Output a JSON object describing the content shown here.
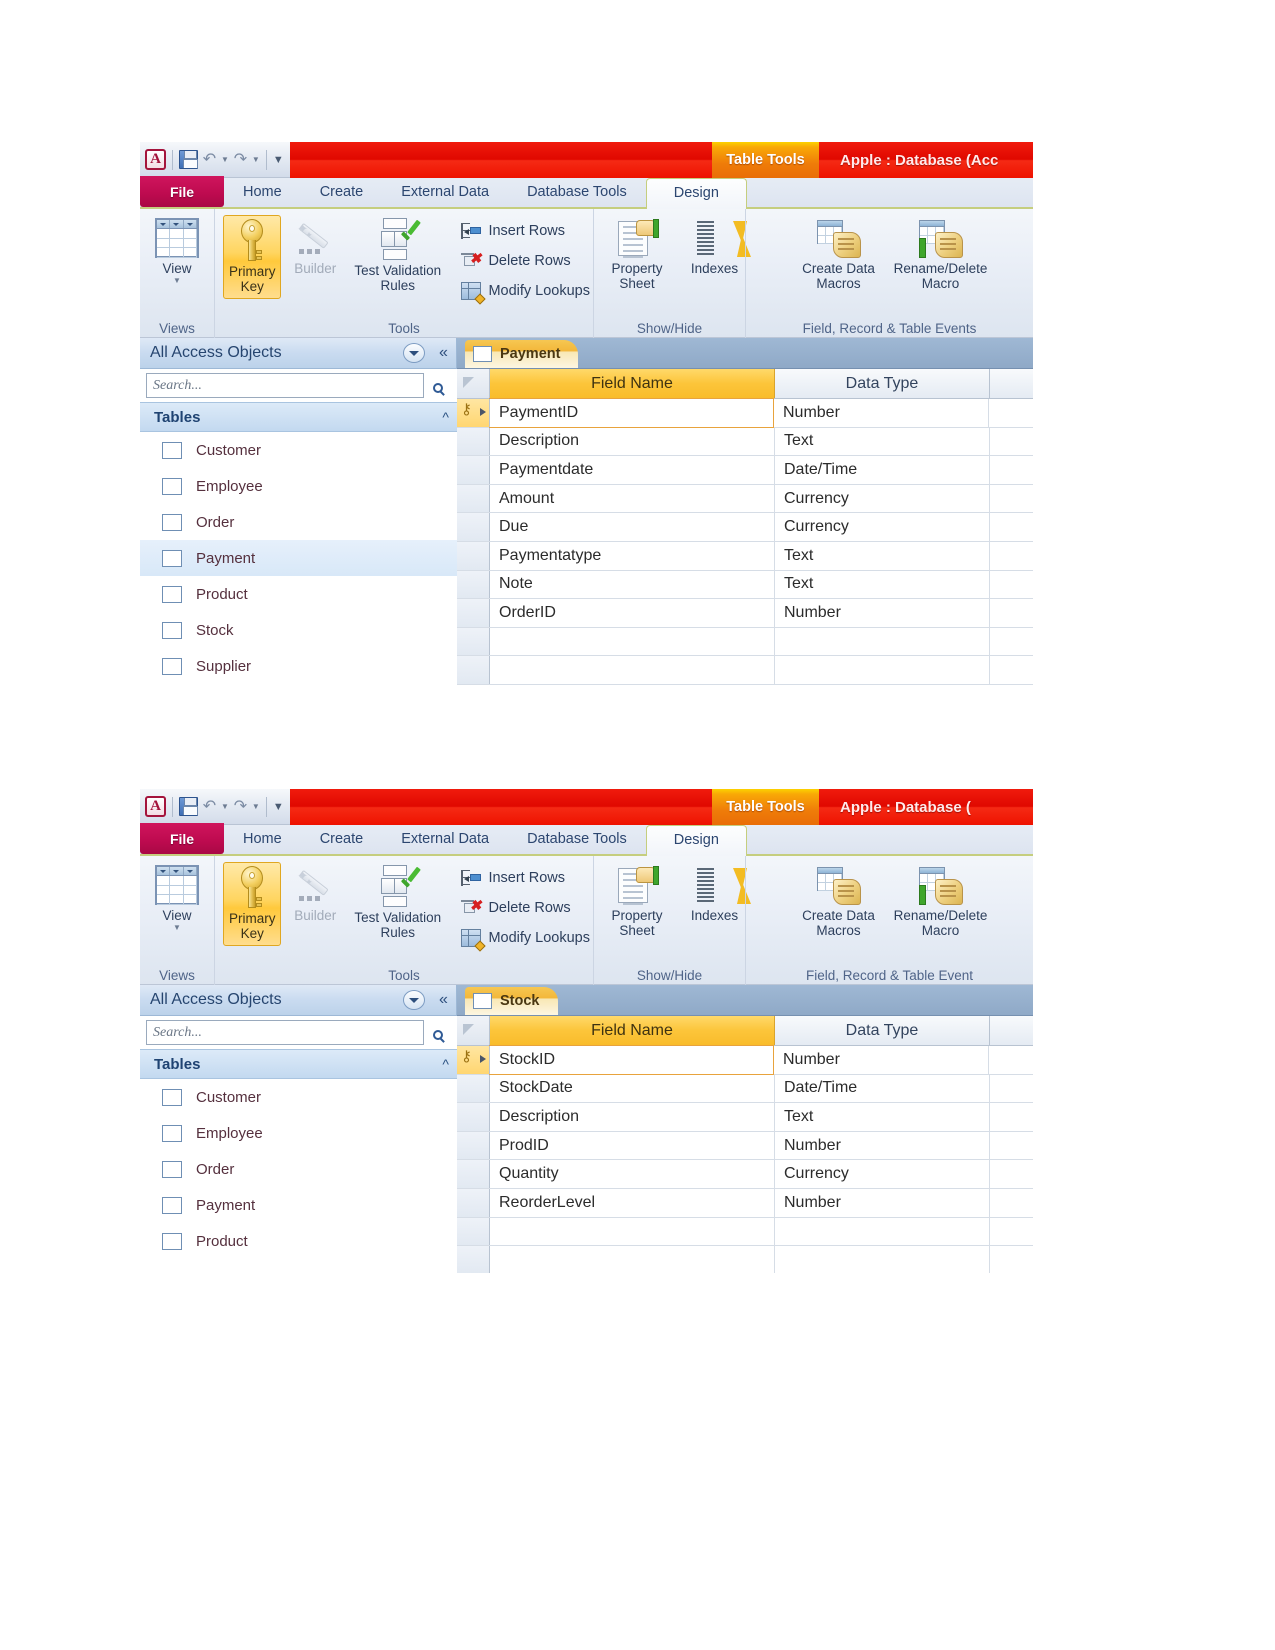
{
  "app": {
    "name": "Microsoft Access 2010",
    "logo_letter": "A",
    "accent_red": "#e00800",
    "accent_orange": "#ef7c09",
    "accent_magenta": "#bf0b50",
    "accent_gold": "#fcc53a"
  },
  "quick_access": {
    "items": [
      {
        "name": "access-logo",
        "label": "A"
      },
      {
        "name": "save-icon",
        "label": "Save"
      },
      {
        "name": "undo-icon",
        "label": "Undo"
      },
      {
        "name": "redo-icon",
        "label": "Redo"
      },
      {
        "name": "customize-qat-icon",
        "label": "Customize Quick Access Toolbar"
      }
    ]
  },
  "screens": [
    {
      "id": "payment-screen",
      "titlebar": {
        "contextual_tab_label": "Table Tools",
        "window_title": "Apple : Database (Acc"
      },
      "tabs": {
        "file": "File",
        "items": [
          "Home",
          "Create",
          "External Data",
          "Database Tools"
        ],
        "active": "Design"
      },
      "ribbon": {
        "groups": [
          {
            "label": "Views",
            "buttons": [
              {
                "label": "View",
                "icon": "view-table-icon",
                "has_dropdown": true
              }
            ]
          },
          {
            "label": "Tools",
            "buttons": [
              {
                "label": "Primary Key",
                "icon": "primary-key-icon",
                "state": "active"
              },
              {
                "label": "Builder",
                "icon": "builder-wand-icon",
                "state": "disabled"
              },
              {
                "label": "Test Validation Rules",
                "icon": "test-validation-icon"
              },
              {
                "label": "Insert Rows",
                "icon": "insert-rows-icon",
                "size": "small"
              },
              {
                "label": "Delete Rows",
                "icon": "delete-rows-icon",
                "size": "small"
              },
              {
                "label": "Modify Lookups",
                "icon": "modify-lookups-icon",
                "size": "small"
              }
            ]
          },
          {
            "label": "Show/Hide",
            "buttons": [
              {
                "label": "Property Sheet",
                "icon": "property-sheet-icon"
              },
              {
                "label": "Indexes",
                "icon": "indexes-icon"
              }
            ]
          },
          {
            "label": "Field, Record & Table Events",
            "buttons": [
              {
                "label": "Create Data Macros",
                "icon": "create-data-macros-icon",
                "has_dropdown": true
              },
              {
                "label": "Rename/Delete Macro",
                "icon": "rename-delete-macro-icon"
              }
            ]
          }
        ]
      },
      "navpane": {
        "title": "All Access Objects",
        "search_placeholder": "Search...",
        "group_label": "Tables",
        "items": [
          {
            "label": "Customer",
            "selected": false
          },
          {
            "label": "Employee",
            "selected": false
          },
          {
            "label": "Order",
            "selected": false
          },
          {
            "label": "Payment",
            "selected": true
          },
          {
            "label": "Product",
            "selected": false
          },
          {
            "label": "Stock",
            "selected": false
          },
          {
            "label": "Supplier",
            "selected": false
          }
        ]
      },
      "document": {
        "tab_label": "Payment",
        "columns": [
          "Field Name",
          "Data Type"
        ],
        "rows": [
          {
            "field": "PaymentID",
            "type": "Number",
            "primary_key": true,
            "active": true
          },
          {
            "field": "Description",
            "type": "Text",
            "primary_key": false,
            "active": false
          },
          {
            "field": "Paymentdate",
            "type": "Date/Time",
            "primary_key": false,
            "active": false
          },
          {
            "field": "Amount",
            "type": "Currency",
            "primary_key": false,
            "active": false
          },
          {
            "field": "Due",
            "type": "Currency",
            "primary_key": false,
            "active": false
          },
          {
            "field": "Paymentatype",
            "type": "Text",
            "primary_key": false,
            "active": false
          },
          {
            "field": "Note",
            "type": "Text",
            "primary_key": false,
            "active": false
          },
          {
            "field": "OrderID",
            "type": "Number",
            "primary_key": false,
            "active": false
          },
          {
            "field": "",
            "type": "",
            "primary_key": false,
            "active": false
          },
          {
            "field": "",
            "type": "",
            "primary_key": false,
            "active": false
          }
        ]
      }
    },
    {
      "id": "stock-screen",
      "titlebar": {
        "contextual_tab_label": "Table Tools",
        "window_title": "Apple : Database ("
      },
      "tabs": {
        "file": "File",
        "items": [
          "Home",
          "Create",
          "External Data",
          "Database Tools"
        ],
        "active": "Design"
      },
      "ribbon": {
        "groups": [
          {
            "label": "Views",
            "buttons": [
              {
                "label": "View",
                "icon": "view-table-icon",
                "has_dropdown": true
              }
            ]
          },
          {
            "label": "Tools",
            "buttons": [
              {
                "label": "Primary Key",
                "icon": "primary-key-icon",
                "state": "active"
              },
              {
                "label": "Builder",
                "icon": "builder-wand-icon",
                "state": "disabled"
              },
              {
                "label": "Test Validation Rules",
                "icon": "test-validation-icon"
              },
              {
                "label": "Insert Rows",
                "icon": "insert-rows-icon",
                "size": "small"
              },
              {
                "label": "Delete Rows",
                "icon": "delete-rows-icon",
                "size": "small"
              },
              {
                "label": "Modify Lookups",
                "icon": "modify-lookups-icon",
                "size": "small"
              }
            ]
          },
          {
            "label": "Show/Hide",
            "buttons": [
              {
                "label": "Property Sheet",
                "icon": "property-sheet-icon"
              },
              {
                "label": "Indexes",
                "icon": "indexes-icon"
              }
            ]
          },
          {
            "label": "Field, Record & Table Event",
            "buttons": [
              {
                "label": "Create Data Macros",
                "icon": "create-data-macros-icon",
                "has_dropdown": true
              },
              {
                "label": "Rename/Delete Macro",
                "icon": "rename-delete-macro-icon"
              }
            ]
          }
        ]
      },
      "navpane": {
        "title": "All Access Objects",
        "search_placeholder": "Search...",
        "group_label": "Tables",
        "items": [
          {
            "label": "Customer",
            "selected": false
          },
          {
            "label": "Employee",
            "selected": false
          },
          {
            "label": "Order",
            "selected": false
          },
          {
            "label": "Payment",
            "selected": false
          },
          {
            "label": "Product",
            "selected": false
          }
        ]
      },
      "document": {
        "tab_label": "Stock",
        "columns": [
          "Field Name",
          "Data Type"
        ],
        "rows": [
          {
            "field": "StockID",
            "type": "Number",
            "primary_key": true,
            "active": true
          },
          {
            "field": "StockDate",
            "type": "Date/Time",
            "primary_key": false,
            "active": false
          },
          {
            "field": "Description",
            "type": "Text",
            "primary_key": false,
            "active": false
          },
          {
            "field": "ProdID",
            "type": "Number",
            "primary_key": false,
            "active": false
          },
          {
            "field": "Quantity",
            "type": "Currency",
            "primary_key": false,
            "active": false
          },
          {
            "field": "ReorderLevel",
            "type": "Number",
            "primary_key": false,
            "active": false
          },
          {
            "field": "",
            "type": "",
            "primary_key": false,
            "active": false
          },
          {
            "field": "",
            "type": "",
            "primary_key": false,
            "active": false
          }
        ]
      }
    }
  ]
}
